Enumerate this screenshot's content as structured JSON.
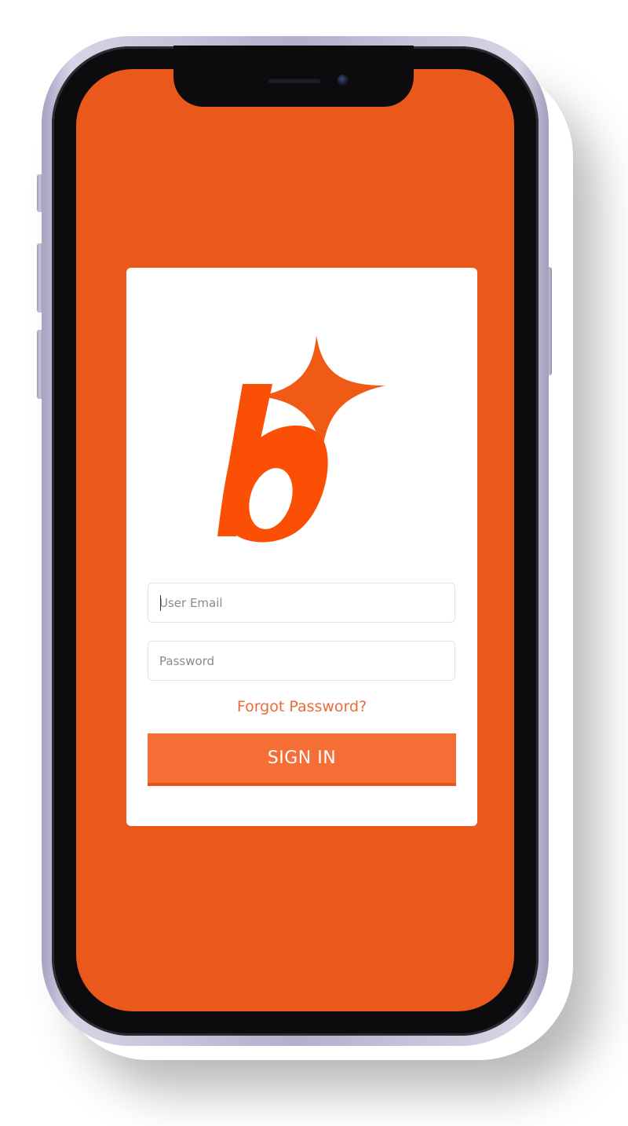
{
  "login": {
    "email_placeholder": "User Email",
    "password_placeholder": "Password",
    "forgot_password": "Forgot Password?",
    "sign_in": "SIGN IN"
  },
  "colors": {
    "screen_background": "#ea581c",
    "brand_orange": "#f05a14",
    "button": "#f56e35",
    "link": "#ec6a3a",
    "phone_frame": "#b3afcb"
  },
  "icons": {
    "logo": "brand-b-sparkle-logo"
  }
}
